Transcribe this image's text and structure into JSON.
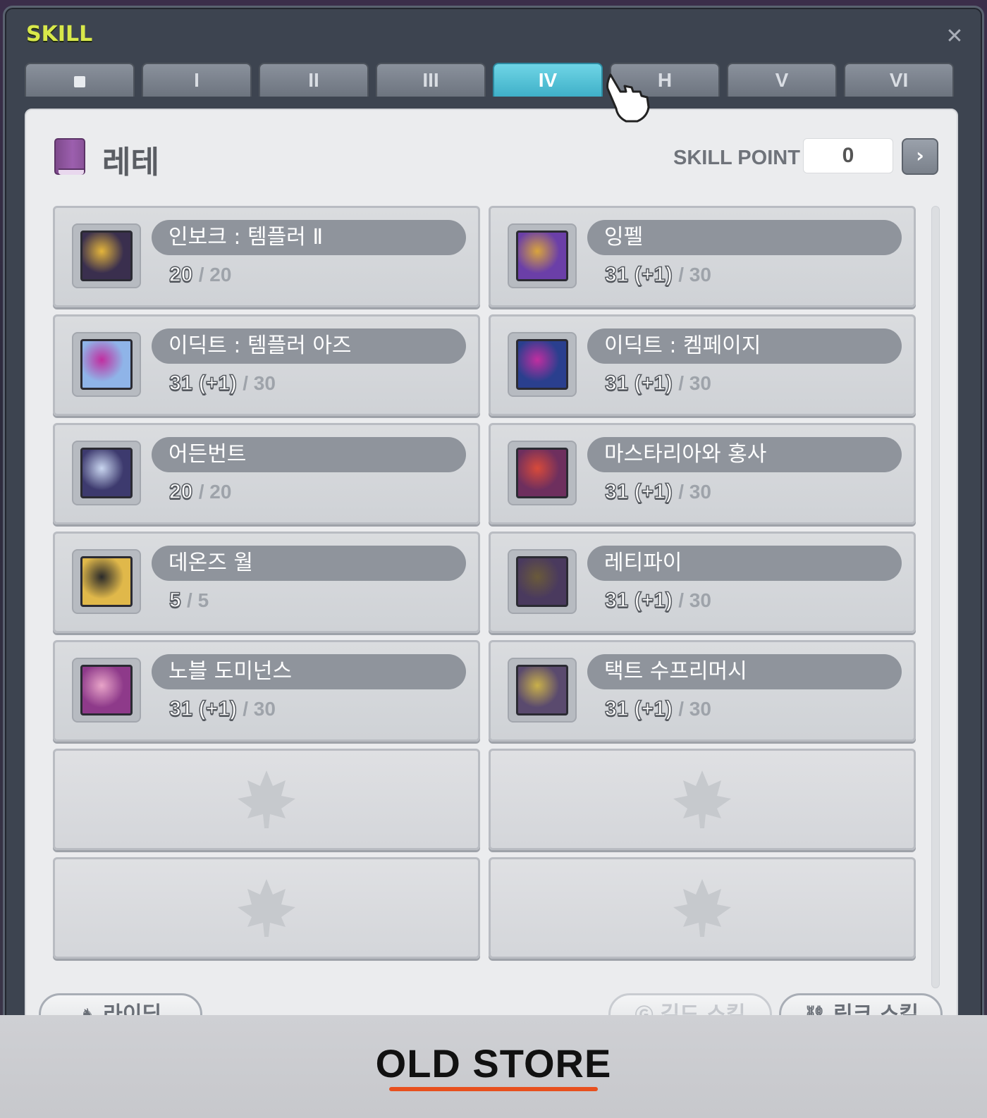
{
  "window": {
    "title": "SKILL",
    "close_glyph": "✕"
  },
  "tabs": [
    {
      "label": "",
      "icon": "square-icon",
      "active": false
    },
    {
      "label": "I",
      "active": false
    },
    {
      "label": "II",
      "active": false
    },
    {
      "label": "III",
      "active": false
    },
    {
      "label": "IV",
      "active": true
    },
    {
      "label": "H",
      "active": false
    },
    {
      "label": "V",
      "active": false
    },
    {
      "label": "VI",
      "active": false
    }
  ],
  "header": {
    "job_name": "레테",
    "skill_point_label": "SKILL POINT",
    "skill_point_value": "0",
    "next_glyph": "›"
  },
  "skills": [
    {
      "name": "인보크 : 템플러 Ⅱ",
      "level": "20",
      "max": "/ 20",
      "icon_color": "#3a2f4e",
      "accent": "#e4b53b"
    },
    {
      "name": "잉펠",
      "level": "31 (+1)",
      "max": "/ 30",
      "icon_color": "#6b3fa8",
      "accent": "#d9a43c"
    },
    {
      "name": "이딕트 : 템플러 아즈",
      "level": "31 (+1)",
      "max": "/ 30",
      "icon_color": "#8fb4e8",
      "accent": "#c02ea0"
    },
    {
      "name": "이딕트 : 켐페이지",
      "level": "31 (+1)",
      "max": "/ 30",
      "icon_color": "#2a3f8e",
      "accent": "#c02ea0"
    },
    {
      "name": "어든번트",
      "level": "20",
      "max": "/ 20",
      "icon_color": "#3d3a6e",
      "accent": "#c9d6f0"
    },
    {
      "name": "마스타리아와 홍사",
      "level": "31 (+1)",
      "max": "/ 30",
      "icon_color": "#6e2f5e",
      "accent": "#d84a3a"
    },
    {
      "name": "데온즈 월",
      "level": "5",
      "max": "/ 5",
      "icon_color": "#e0b84a",
      "accent": "#2a2a2a"
    },
    {
      "name": "레티파이",
      "level": "31 (+1)",
      "max": "/ 30",
      "icon_color": "#4a3a5e",
      "accent": "#6a5a3a"
    },
    {
      "name": "노블 도미넌스",
      "level": "31 (+1)",
      "max": "/ 30",
      "icon_color": "#8e3a8a",
      "accent": "#e8a4c8"
    },
    {
      "name": "택트 수프리머시",
      "level": "31 (+1)",
      "max": "/ 30",
      "icon_color": "#5a4a6e",
      "accent": "#c9b04a"
    }
  ],
  "bottom": {
    "riding_label": "라이딩",
    "guild_skill_label": "길드 스킬",
    "link_skill_label": "링크 스킬"
  },
  "footer": {
    "text": "OLD STORE",
    "underline_color": "#e8501e"
  }
}
